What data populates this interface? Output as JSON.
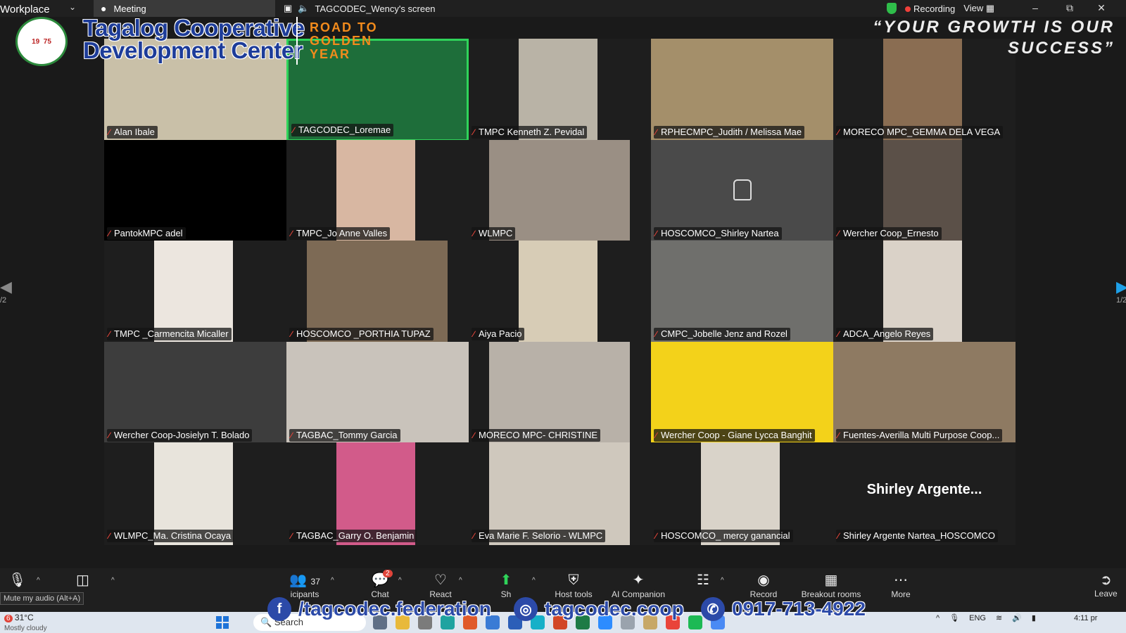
{
  "app": {
    "name": "Workplace"
  },
  "tabs": [
    {
      "label": "Meeting"
    }
  ],
  "share_banner": "TAGCODEC_Wency's screen",
  "status": {
    "recording": "Recording",
    "view": "View"
  },
  "branding": {
    "org_line1": "Tagalog Cooperative",
    "org_line2": "Development Center",
    "road_line1": "ROAD TO",
    "road_line2": "GOLDEN",
    "road_line3": "YEAR",
    "quote_line1": "“YOUR GROWTH IS OUR",
    "quote_line2": "SUCCESS”",
    "logo_year_left": "19",
    "logo_year_right": "75"
  },
  "participants": [
    {
      "name": "Alan Ibale",
      "color": "#c9c0a8"
    },
    {
      "name": "TAGCODEC_Loremae",
      "color": "#1e6e3a"
    },
    {
      "name": "TMPC Kenneth Z. Pevidal",
      "color": "#b9b3a6"
    },
    {
      "name": "RPHECMPC_Judith / Melissa Mae",
      "color": "#a48f6a"
    },
    {
      "name": "MORECO MPC_GEMMA DELA VEGA",
      "color": "#8a6d52"
    },
    {
      "name": "PantokMPC adel",
      "color": "#000000"
    },
    {
      "name": "TMPC_Jo Anne Valles",
      "color": "#d8b7a2"
    },
    {
      "name": "WLMPC",
      "color": "#9a8f84"
    },
    {
      "name": "HOSCOMCO_Shirley Nartea",
      "color": "#4a4a4a"
    },
    {
      "name": "Wercher Coop_Ernesto",
      "color": "#5b5048"
    },
    {
      "name": "TMPC _Carmencita Micaller",
      "color": "#ece6df"
    },
    {
      "name": "HOSCOMCO _PORTHIA TUPAZ",
      "color": "#7d6a55"
    },
    {
      "name": "Aiya Pacio",
      "color": "#d7ccb6"
    },
    {
      "name": "CMPC_Jobelle Jenz and Rozel",
      "color": "#6f6f6c"
    },
    {
      "name": "ADCA_Angelo Reyes",
      "color": "#dad2c8"
    },
    {
      "name": "Wercher Coop-Josielyn T. Bolado",
      "color": "#3d3d3d"
    },
    {
      "name": "TAGBAC_Tommy Garcia",
      "color": "#c9c3bb"
    },
    {
      "name": "MORECO MPC- CHRISTINE",
      "color": "#b8b1a8"
    },
    {
      "name": "Wercher Coop - Giane Lycca Banghit",
      "color": "#f3d21a"
    },
    {
      "name": "Fuentes-Averilla Multi Purpose Coop...",
      "color": "#8e7a62"
    },
    {
      "name": "WLMPC_Ma. Cristina Ocaya",
      "color": "#e8e4dc"
    },
    {
      "name": "TAGBAC_Garry O. Benjamin",
      "color": "#d25b8a"
    },
    {
      "name": "Eva Marie F. Selorio - WLMPC",
      "color": "#cfc8bd"
    },
    {
      "name": "HOSCOMCO_ mercy ganancial",
      "color": "#d9d3c9"
    },
    {
      "name": "Shirley Argente Nartea_HOSCOMCO",
      "color": "#1e1e1e"
    }
  ],
  "big_name": "Shirley  Argente...",
  "pager": {
    "left": "/2",
    "right": "1/2"
  },
  "toolbar": {
    "mute_tip": "Mute my audio (Alt+A)",
    "participants_count": "37",
    "participants_label": "icipants",
    "chat_label": "Chat",
    "chat_badge": "2",
    "react_label": "React",
    "share_label": "Sh",
    "host_tools_label": "Host tools",
    "ai_label": "AI Companion",
    "record_label": "Record",
    "breakout_label": "Breakout rooms",
    "more_label": "More",
    "leave_label": "Leave"
  },
  "social": {
    "facebook": "/tagcodec.federation",
    "web": "tagcodec.coop",
    "phone": "0917-713-4922"
  },
  "taskbar": {
    "weather_badge": "6",
    "temperature": "31°C",
    "weather_sub": "Mostly cloudy",
    "search": "Search",
    "language": "ENG",
    "time": "4:11 pr"
  }
}
